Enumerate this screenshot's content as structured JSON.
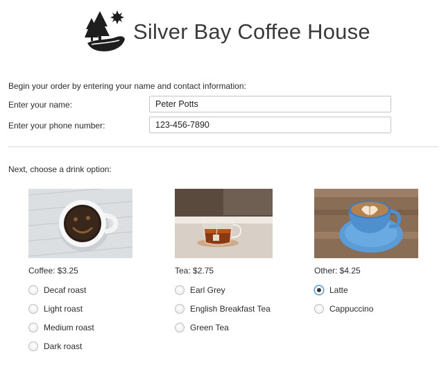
{
  "header": {
    "brand": "Silver Bay Coffee House",
    "logo_icon": "trees-sun-logo-icon"
  },
  "contact": {
    "intro": "Begin your order by entering your name and contact information:",
    "name_label": "Enter your name:",
    "name_value": "Peter Potts",
    "phone_label": "Enter your phone number:",
    "phone_value": "123-456-7890"
  },
  "drinks": {
    "prompt": "Next, choose a drink option:",
    "coffee": {
      "label": "Coffee: $3.25",
      "options": [
        "Decaf roast",
        "Light roast",
        "Medium roast",
        "Dark roast"
      ]
    },
    "tea": {
      "label": "Tea: $2.75",
      "options": [
        "Earl Grey",
        "English Breakfast Tea",
        "Green Tea"
      ]
    },
    "other": {
      "label": "Other: $4.25",
      "options": [
        "Latte",
        "Cappuccino"
      ],
      "selected": "Latte"
    }
  },
  "colors": {
    "accent": "#4a90c8",
    "divider": "#d9d9d9",
    "text": "#2b2b2b"
  }
}
